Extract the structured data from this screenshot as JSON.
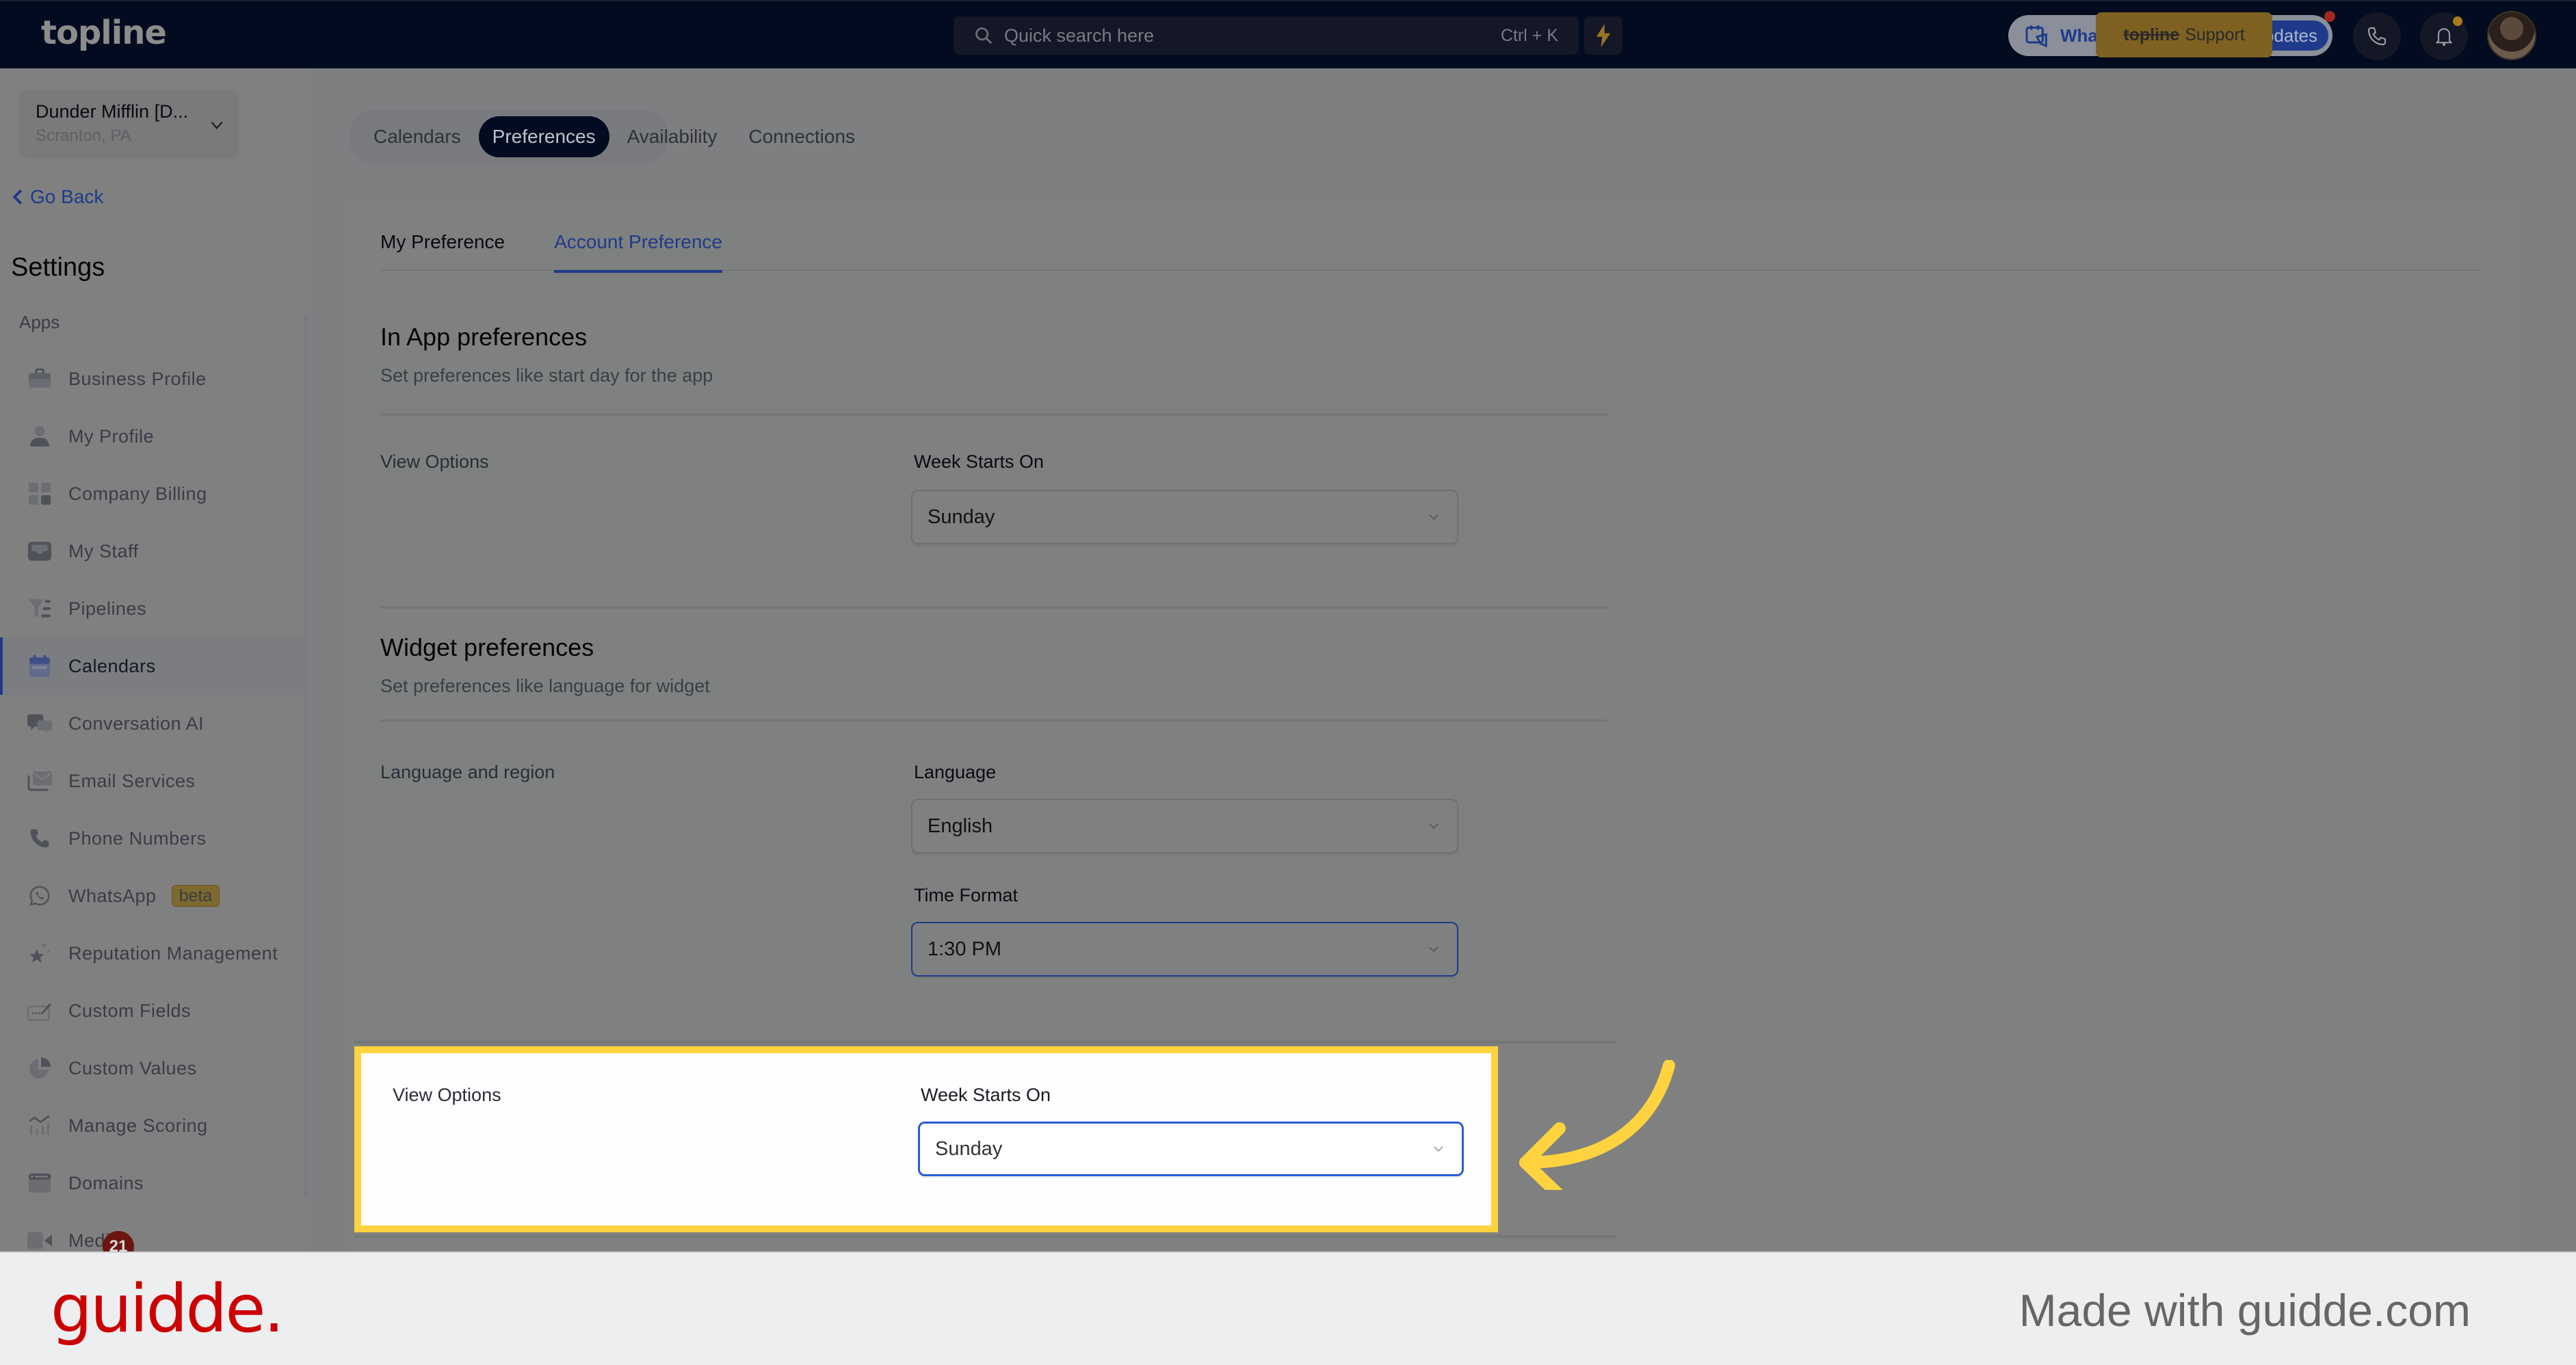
{
  "header": {
    "logo": "topline",
    "search_placeholder": "Quick search here",
    "search_shortcut": "Ctrl + K",
    "whats_new_label": "What's New",
    "updates_label": "Updates",
    "support_tooltip_brand": "topline",
    "support_tooltip_text": "Support",
    "icons": [
      "search-icon",
      "lightning-icon",
      "megaphone-icon",
      "phone-icon",
      "bell-icon",
      "avatar"
    ]
  },
  "sidebar": {
    "account_name": "Dunder Mifflin [D...",
    "account_location": "Scranton, PA",
    "go_back": "Go Back",
    "title": "Settings",
    "group_label": "Apps",
    "items": [
      {
        "label": "Business Profile",
        "icon": "briefcase-icon"
      },
      {
        "label": "My Profile",
        "icon": "person-icon"
      },
      {
        "label": "Company Billing",
        "icon": "calculator-icon"
      },
      {
        "label": "My Staff",
        "icon": "inbox-icon"
      },
      {
        "label": "Pipelines",
        "icon": "filter-icon"
      },
      {
        "label": "Calendars",
        "icon": "calendar-icon",
        "active": true
      },
      {
        "label": "Conversation AI",
        "icon": "chat-bubbles-icon"
      },
      {
        "label": "Email Services",
        "icon": "envelope-icon"
      },
      {
        "label": "Phone Numbers",
        "icon": "phone-icon"
      },
      {
        "label": "WhatsApp",
        "icon": "whatsapp-icon",
        "badge": "beta"
      },
      {
        "label": "Reputation Management",
        "icon": "star-sparkle-icon"
      },
      {
        "label": "Custom Fields",
        "icon": "edit-field-icon"
      },
      {
        "label": "Custom Values",
        "icon": "pie-chart-icon"
      },
      {
        "label": "Manage Scoring",
        "icon": "chart-icon"
      },
      {
        "label": "Domains",
        "icon": "browser-window-icon"
      },
      {
        "label": "Media",
        "icon": "video-camera-icon"
      }
    ],
    "notification_count": "21"
  },
  "main": {
    "pill_tabs": [
      {
        "label": "Calendars",
        "active": false
      },
      {
        "label": "Preferences",
        "active": true
      },
      {
        "label": "Availability",
        "active": false
      },
      {
        "label": "Connections",
        "active": false
      }
    ],
    "sub_tabs": [
      {
        "label": "My Preference",
        "active": false
      },
      {
        "label": "Account Preference",
        "active": true
      }
    ],
    "in_app": {
      "title": "In App preferences",
      "description": "Set preferences like start day for the app",
      "row_label": "View Options",
      "field_label": "Week Starts On",
      "value": "Sunday"
    },
    "widget": {
      "title": "Widget preferences",
      "description": "Set preferences like language for widget",
      "row_label": "Language and region",
      "language_label": "Language",
      "language_value": "English",
      "time_format_label": "Time Format",
      "time_format_value": "1:30 PM"
    },
    "highlighted": {
      "row_label": "View Options",
      "field_label": "Week Starts On",
      "value": "Sunday"
    }
  },
  "footer": {
    "logo": "guidde.",
    "tagline": "Made with guidde.com"
  },
  "colors": {
    "navy": "#020b1f",
    "accent_blue": "#1f3a8a",
    "highlight_yellow": "#ffd23f",
    "guidde_red": "#cc0000",
    "focus_blue": "#2a5bd7"
  }
}
